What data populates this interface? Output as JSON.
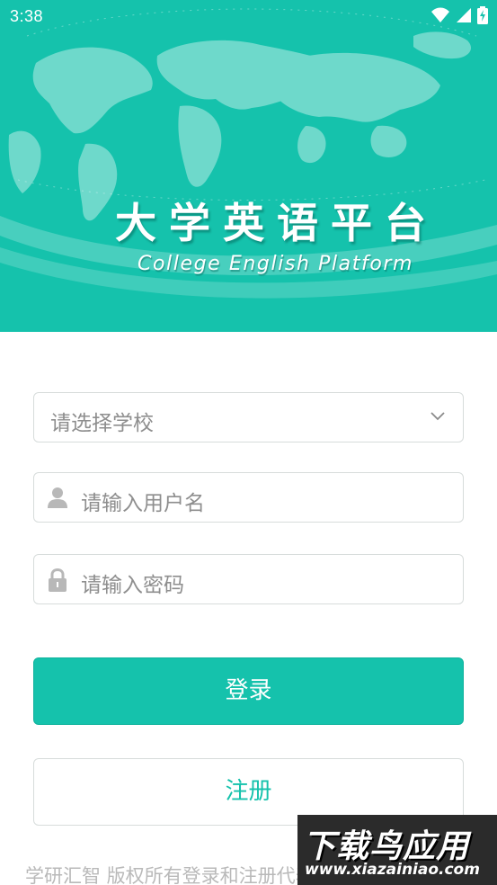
{
  "status_bar": {
    "time": "3:38"
  },
  "hero": {
    "title": "大学英语平台",
    "subtitle": "College English Platform"
  },
  "form": {
    "school_select": {
      "placeholder": "请选择学校"
    },
    "username": {
      "placeholder": "请输入用户名"
    },
    "password": {
      "placeholder": "请输入密码"
    }
  },
  "buttons": {
    "login": "登录",
    "register": "注册"
  },
  "footer": {
    "text": "学研汇智 版权所有登录和注册代表同意用户协"
  },
  "watermark": {
    "brand": "下载鸟应用",
    "url": "www.xiazainiao.com"
  },
  "colors": {
    "accent": "#15c2ac",
    "border": "#d7dcdb",
    "placeholder": "#8e8e8e",
    "icon": "#b8b8b8"
  },
  "icons": [
    "wifi-icon",
    "cellular-signal-icon",
    "battery-charging-icon",
    "chevron-down-icon",
    "user-icon",
    "lock-icon"
  ]
}
